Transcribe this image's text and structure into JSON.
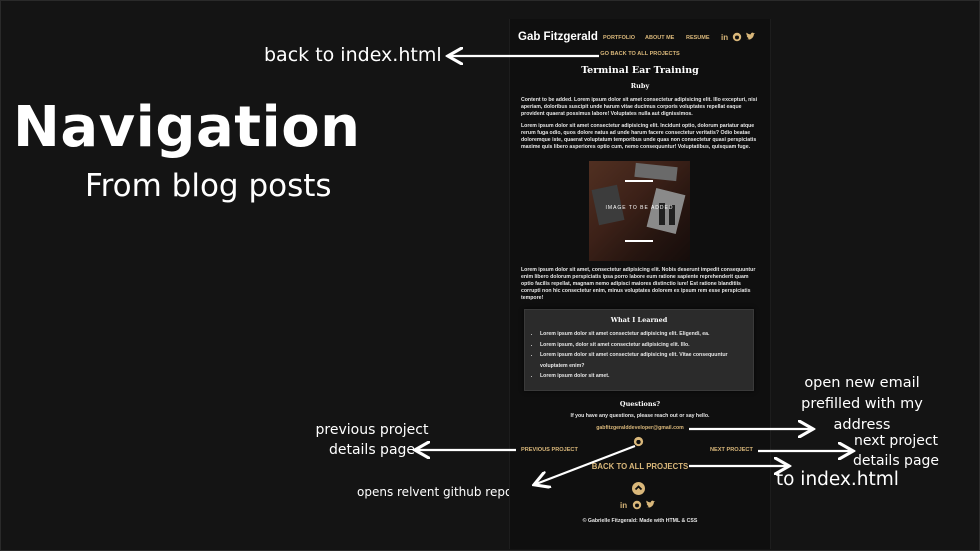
{
  "slide": {
    "title": "Navigation",
    "subtitle": "From blog posts"
  },
  "annotations": {
    "back_top": "back to index.html",
    "email": "open new email prefilled with my address",
    "email_l1": "open new email",
    "email_l2": "prefilled with my",
    "email_l3": "address",
    "prev_l1": "previous project",
    "prev_l2": "details page",
    "next_l1": "next project",
    "next_l2": "details page",
    "github": "opens relvent github repo for more detalils",
    "back_bottom": "back to index.html"
  },
  "site": {
    "brand": "Gab Fitzgerald",
    "nav": [
      "PORTFOLIO",
      "ABOUT ME",
      "RESUME"
    ],
    "social_icons": [
      "linkedin-icon",
      "github-icon",
      "twitter-icon"
    ],
    "back_link": "GO BACK TO ALL PROJECTS",
    "project_title": "Terminal Ear Training",
    "language": "Ruby",
    "para1": "Content to be added. Lorem ipsum dolor sit amet consectetur adipisicing elit. Illo excepturi, nisi aperiam, doloribus suscipit unde harum vitae ducimus corporis voluptates repellat eaque provident quaerat possimus labore! Voluptates nulla aut dignissimos.",
    "para2": "Lorem ipsum dolor sit amet consectetur adipisicing elit. Incidunt optio, dolorum pariatur atque rerum fuga odio, quos dolore natus ad unde harum facere consectetur veritatis? Odio beatae doloremque iste, quaerat voluptatum temporibus unde quas non consectetur quasi perspiciatis maxime quis libero asperiores optio cum, nemo consequuntur! Voluptatibus, quisquam fuge.",
    "image_caption": "IMAGE TO BE ADDED",
    "para3": "Lorem ipsum dolor sit amet, consectetur adipisicing elit. Nobis deserunt impedit consequuntur enim libero dolorum perspiciatis ipsa porro labore eum ratione sapiente reprehenderit quam optio facilis repellat, magnam nemo adipisci maiores distinctio iure! Est ratione blanditiis corrupti non hic consectetur enim, minus voluptates dolorem ex ipsum rem esse perspiciatis tempore!",
    "learned_title": "What I Learned",
    "learned_items": [
      "Lorem ipsum dolor sit amet consectetur adipisicing elit. Eligendi, ea.",
      "Lorem ipsum, dolor sit amet consectetur adipisicing elit. Illo.",
      "Lorem ipsum dolor sit amet consectetur adipisicing elit. Vitae consequuntur voluptatem enim?",
      "Lorem ipsum dolor sit amet."
    ],
    "questions_title": "Questions?",
    "questions_text": "If you have any questions, please reach out or say hello.",
    "email": "gabfitzgeralddeveloper@gmail.com",
    "prev_label": "PREVIOUS PROJECT",
    "next_label": "NEXT PROJECT",
    "back_all": "BACK TO ALL PROJECTS",
    "footer": "© Gabrielle Fitzgerald: Made with HTML & CSS"
  },
  "colors": {
    "accent": "#d9b77a",
    "background": "#141414",
    "site_bg": "#0f0f0f"
  }
}
